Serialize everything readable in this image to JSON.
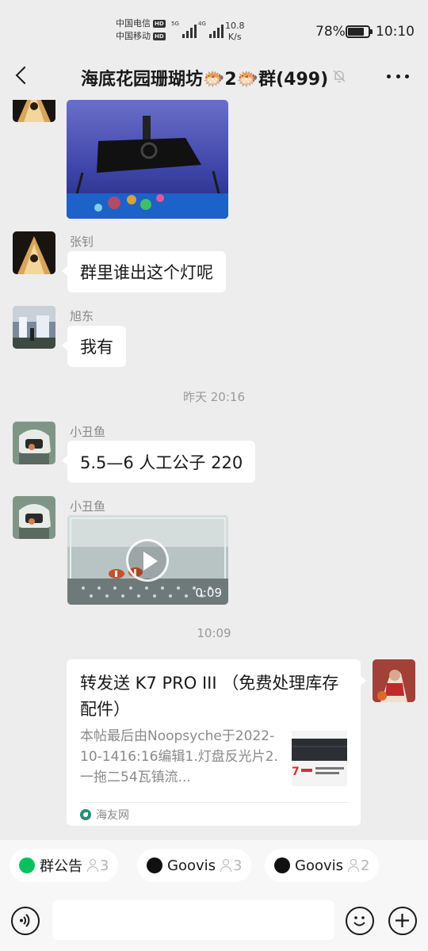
{
  "status_bar": {
    "carrier1": "中国电信",
    "carrier2": "中国移动",
    "hd": "HD",
    "net_5g": "5G",
    "net_4g": "4G",
    "net_speed_value": "10.8",
    "net_speed_unit": "K/s",
    "battery_pct": "78%",
    "battery_level": 0.78,
    "time": "10:10"
  },
  "header": {
    "title": "海底花园珊瑚坊🐡2🐡群(499)"
  },
  "messages": {
    "m1": {
      "sender": "张钊",
      "text": "群里谁出这个灯呢"
    },
    "m2": {
      "sender": "旭东",
      "text": "我有"
    },
    "time1": "昨天 20:16",
    "m3": {
      "sender": "小丑鱼",
      "text": "5.5—6 人工公子   220"
    },
    "m4": {
      "sender": "小丑鱼",
      "duration": "0:09"
    },
    "time2": "10:09",
    "card": {
      "title": "转发送 K7 PRO III （免费处理库存配件）",
      "desc": "本帖最后由Noopsyche于2022-10-1416:16编辑1.灯盘反光片2.一拖二54瓦镇流...",
      "source": "海友网"
    }
  },
  "chips": [
    {
      "label": "群公告",
      "count": "3",
      "color": "#07c160"
    },
    {
      "label": "Goovis",
      "count": "3",
      "color": "#111111"
    },
    {
      "label": "Goovis",
      "count": "2",
      "color": "#111111"
    }
  ],
  "colors": {
    "background": "#ededed",
    "bubble": "#ffffff",
    "accent": "#07c160"
  }
}
